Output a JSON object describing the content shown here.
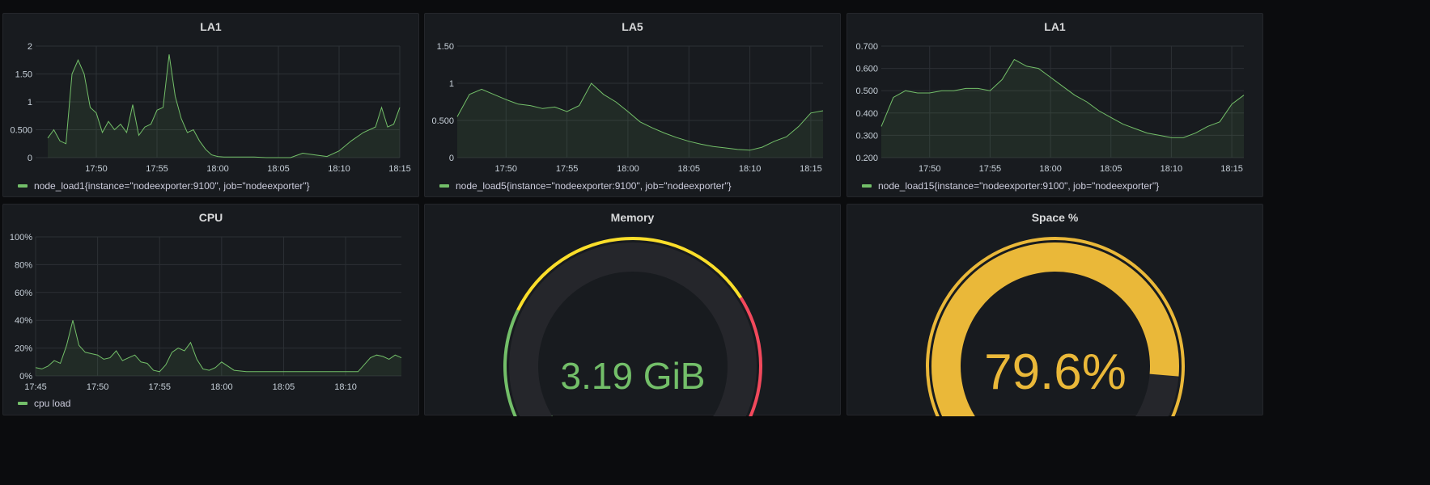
{
  "colors": {
    "series": "#73bf69",
    "gauge_green": "#73bf69",
    "gauge_yellow": "#fade2a",
    "gauge_red": "#f2495c",
    "gauge_orange": "#eab839",
    "background": "#0b0c0e",
    "panel": "#181b1f"
  },
  "panels": {
    "la1": {
      "title": "LA1",
      "legend": "node_load1{instance=\"nodeexporter:9100\", job=\"nodeexporter\"}"
    },
    "la5": {
      "title": "LA5",
      "legend": "node_load5{instance=\"nodeexporter:9100\", job=\"nodeexporter\"}"
    },
    "la15": {
      "title": "LA1",
      "legend": "node_load15{instance=\"nodeexporter:9100\", job=\"nodeexporter\"}"
    },
    "cpu": {
      "title": "CPU",
      "legend": "cpu load"
    },
    "memory": {
      "title": "Memory",
      "value_text": "3.19 GiB",
      "fraction": 0.12
    },
    "space": {
      "title": "Space %",
      "value_text": "79.6%",
      "fraction": 0.796
    }
  },
  "chart_data": [
    {
      "type": "area",
      "title": "LA1",
      "xlabel": "",
      "ylabel": "",
      "x_ticks": [
        "17:50",
        "17:55",
        "18:00",
        "18:05",
        "18:10",
        "18:15"
      ],
      "y_ticks": [
        "0",
        "0.500",
        "1",
        "1.50",
        "2"
      ],
      "ylim": [
        0,
        2
      ],
      "xlim": [
        "17:45",
        "18:15"
      ],
      "grid": true,
      "legend_position": "bottom-left",
      "series": [
        {
          "name": "node_load1{instance=\"nodeexporter:9100\", job=\"nodeexporter\"}",
          "x": [
            "17:46",
            "17:46:30",
            "17:47",
            "17:47:30",
            "17:48",
            "17:48:30",
            "17:49",
            "17:49:30",
            "17:50",
            "17:50:30",
            "17:51",
            "17:51:30",
            "17:52",
            "17:52:30",
            "17:53",
            "17:53:30",
            "17:54",
            "17:54:30",
            "17:55",
            "17:55:30",
            "17:56",
            "17:56:30",
            "17:57",
            "17:57:30",
            "17:58",
            "17:58:30",
            "17:59",
            "17:59:30",
            "18:00",
            "18:00:30",
            "18:01",
            "18:02",
            "18:03",
            "18:04",
            "18:05",
            "18:06",
            "18:07",
            "18:08",
            "18:09",
            "18:10",
            "18:11",
            "18:12",
            "18:13",
            "18:13:30",
            "18:14",
            "18:14:30",
            "18:15"
          ],
          "values": [
            0.35,
            0.5,
            0.3,
            0.25,
            1.5,
            1.75,
            1.5,
            0.9,
            0.8,
            0.45,
            0.65,
            0.5,
            0.6,
            0.45,
            0.95,
            0.4,
            0.55,
            0.6,
            0.85,
            0.9,
            1.85,
            1.1,
            0.7,
            0.45,
            0.5,
            0.3,
            0.15,
            0.05,
            0.02,
            0.01,
            0.01,
            0.01,
            0.01,
            0.0,
            0.0,
            0.0,
            0.08,
            0.05,
            0.02,
            0.12,
            0.3,
            0.45,
            0.55,
            0.9,
            0.55,
            0.6,
            0.9
          ]
        }
      ]
    },
    {
      "type": "area",
      "title": "LA5",
      "xlabel": "",
      "ylabel": "",
      "x_ticks": [
        "17:50",
        "17:55",
        "18:00",
        "18:05",
        "18:10",
        "18:15"
      ],
      "y_ticks": [
        "0",
        "0.500",
        "1",
        "1.50"
      ],
      "ylim": [
        0,
        1.5
      ],
      "xlim": [
        "17:46",
        "18:16"
      ],
      "grid": true,
      "legend_position": "bottom-left",
      "series": [
        {
          "name": "node_load5{instance=\"nodeexporter:9100\", job=\"nodeexporter\"}",
          "x": [
            "17:46",
            "17:47",
            "17:48",
            "17:49",
            "17:50",
            "17:51",
            "17:52",
            "17:53",
            "17:54",
            "17:55",
            "17:56",
            "17:57",
            "17:58",
            "17:59",
            "18:00",
            "18:01",
            "18:02",
            "18:03",
            "18:04",
            "18:05",
            "18:06",
            "18:07",
            "18:08",
            "18:09",
            "18:10",
            "18:11",
            "18:12",
            "18:13",
            "18:14",
            "18:15",
            "18:16"
          ],
          "values": [
            0.55,
            0.85,
            0.92,
            0.85,
            0.78,
            0.72,
            0.7,
            0.66,
            0.68,
            0.62,
            0.7,
            1.0,
            0.85,
            0.75,
            0.62,
            0.48,
            0.4,
            0.33,
            0.27,
            0.22,
            0.18,
            0.15,
            0.13,
            0.11,
            0.1,
            0.14,
            0.22,
            0.28,
            0.42,
            0.6,
            0.63
          ]
        }
      ]
    },
    {
      "type": "area",
      "title": "LA1",
      "xlabel": "",
      "ylabel": "",
      "x_ticks": [
        "17:50",
        "17:55",
        "18:00",
        "18:05",
        "18:10",
        "18:15"
      ],
      "y_ticks": [
        "0.200",
        "0.300",
        "0.400",
        "0.500",
        "0.600",
        "0.700"
      ],
      "ylim": [
        0.2,
        0.7
      ],
      "xlim": [
        "17:46",
        "18:16"
      ],
      "grid": true,
      "legend_position": "bottom-left",
      "series": [
        {
          "name": "node_load15{instance=\"nodeexporter:9100\", job=\"nodeexporter\"}",
          "x": [
            "17:46",
            "17:47",
            "17:48",
            "17:49",
            "17:50",
            "17:51",
            "17:52",
            "17:53",
            "17:54",
            "17:55",
            "17:56",
            "17:57",
            "17:58",
            "17:59",
            "18:00",
            "18:01",
            "18:02",
            "18:03",
            "18:04",
            "18:05",
            "18:06",
            "18:07",
            "18:08",
            "18:09",
            "18:10",
            "18:11",
            "18:12",
            "18:13",
            "18:14",
            "18:15",
            "18:16"
          ],
          "values": [
            0.34,
            0.47,
            0.5,
            0.49,
            0.49,
            0.5,
            0.5,
            0.51,
            0.51,
            0.5,
            0.55,
            0.64,
            0.61,
            0.6,
            0.56,
            0.52,
            0.48,
            0.45,
            0.41,
            0.38,
            0.35,
            0.33,
            0.31,
            0.3,
            0.29,
            0.29,
            0.31,
            0.34,
            0.36,
            0.44,
            0.48
          ]
        }
      ]
    },
    {
      "type": "area",
      "title": "CPU",
      "xlabel": "",
      "ylabel": "",
      "x_ticks": [
        "17:45",
        "17:50",
        "17:55",
        "18:00",
        "18:05",
        "18:10"
      ],
      "y_ticks": [
        "0%",
        "20%",
        "40%",
        "60%",
        "80%",
        "100%"
      ],
      "ylim": [
        0,
        100
      ],
      "xlim": [
        "17:45",
        "18:14:30"
      ],
      "grid": true,
      "legend_position": "bottom-left",
      "series": [
        {
          "name": "cpu load",
          "x": [
            "17:45",
            "17:45:30",
            "17:46",
            "17:46:30",
            "17:47",
            "17:47:30",
            "17:48",
            "17:48:30",
            "17:49",
            "17:49:30",
            "17:50",
            "17:50:30",
            "17:51",
            "17:51:30",
            "17:52",
            "17:52:30",
            "17:53",
            "17:53:30",
            "17:54",
            "17:54:30",
            "17:55",
            "17:55:30",
            "17:56",
            "17:56:30",
            "17:57",
            "17:57:30",
            "17:58",
            "17:58:30",
            "17:59",
            "17:59:30",
            "18:00",
            "18:01",
            "18:02",
            "18:03",
            "18:04",
            "18:05",
            "18:06",
            "18:07",
            "18:08",
            "18:09",
            "18:10",
            "18:11",
            "18:12",
            "18:12:30",
            "18:13",
            "18:13:30",
            "18:14",
            "18:14:30"
          ],
          "values": [
            6,
            5,
            7,
            11,
            9,
            22,
            40,
            22,
            17,
            16,
            15,
            12,
            13,
            18,
            11,
            13,
            15,
            10,
            9,
            4,
            3,
            8,
            17,
            20,
            18,
            24,
            12,
            5,
            4,
            6,
            10,
            4,
            3,
            3,
            3,
            3,
            3,
            3,
            3,
            3,
            3,
            3,
            13,
            15,
            14,
            12,
            15,
            13
          ]
        }
      ]
    }
  ]
}
